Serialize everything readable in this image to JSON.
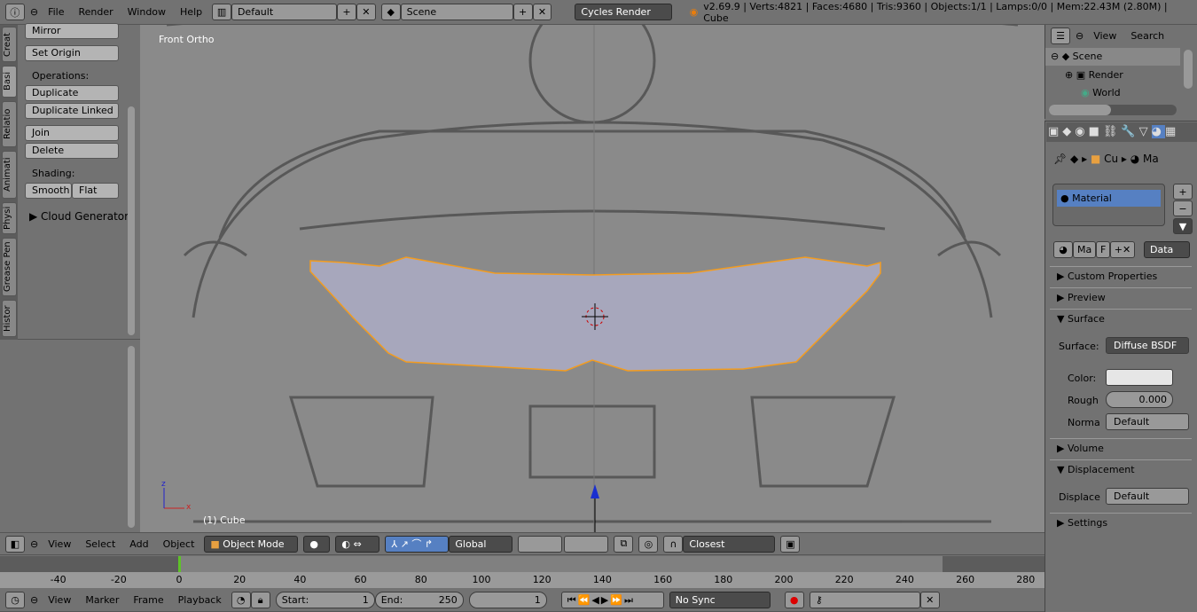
{
  "top": {
    "menus": [
      "File",
      "Render",
      "Window",
      "Help"
    ],
    "layout": "Default",
    "scene": "Scene",
    "engine": "Cycles Render",
    "stats": "v2.69.9 | Verts:4821 | Faces:4680 | Tris:9360 | Objects:1/1 | Lamps:0/0 | Mem:22.43M (2.80M) | Cube"
  },
  "tools": {
    "tabs": [
      "Creat",
      "Basi",
      "Relatio",
      "Animati",
      "Physi",
      "Grease Pen",
      "Histor"
    ],
    "mirror": "Mirror",
    "set_origin": "Set Origin",
    "operations": "Operations:",
    "duplicate": "Duplicate",
    "duplicate_linked": "Duplicate Linked",
    "join": "Join",
    "delete": "Delete",
    "shading": "Shading:",
    "smooth": "Smooth",
    "flat": "Flat",
    "cloud": "Cloud Generator"
  },
  "viewport": {
    "view_label": "Front Ortho",
    "object_label": "(1) Cube"
  },
  "view_header": {
    "menus": [
      "View",
      "Select",
      "Add",
      "Object"
    ],
    "mode": "Object Mode",
    "orientation": "Global",
    "snap": "Closest"
  },
  "timeline": {
    "ticks": [
      -40,
      -20,
      0,
      20,
      40,
      60,
      80,
      100,
      120,
      140,
      160,
      180,
      200,
      220,
      240,
      260,
      280
    ],
    "current_frame": 1,
    "start_label": "Start:",
    "start": "1",
    "end_label": "End:",
    "end": "250",
    "menus": [
      "View",
      "Marker",
      "Frame",
      "Playback"
    ],
    "sync": "No Sync"
  },
  "outliner": {
    "menus": [
      "View",
      "Search"
    ],
    "items": [
      "Scene",
      "Render",
      "World"
    ]
  },
  "properties": {
    "crumbs": [
      "Cu",
      "Ma"
    ],
    "material_slot": "Material",
    "mat_name": "Ma",
    "mat_f": "F",
    "data": "Data",
    "panels": {
      "custom": "Custom Properties",
      "preview": "Preview",
      "surface": "Surface",
      "volume": "Volume",
      "displacement": "Displacement",
      "settings": "Settings"
    },
    "surface_label": "Surface:",
    "surface_value": "Diffuse BSDF",
    "color_label": "Color:",
    "color_value": "#e6e6e6",
    "rough_label": "Rough",
    "rough_value": "0.000",
    "normal_label": "Norma",
    "normal_value": "Default",
    "displace_label": "Displace",
    "displace_value": "Default"
  },
  "colors": {
    "accent": "#5680c2",
    "selection": "#f39c1f",
    "frame_marker": "#5ec228"
  }
}
